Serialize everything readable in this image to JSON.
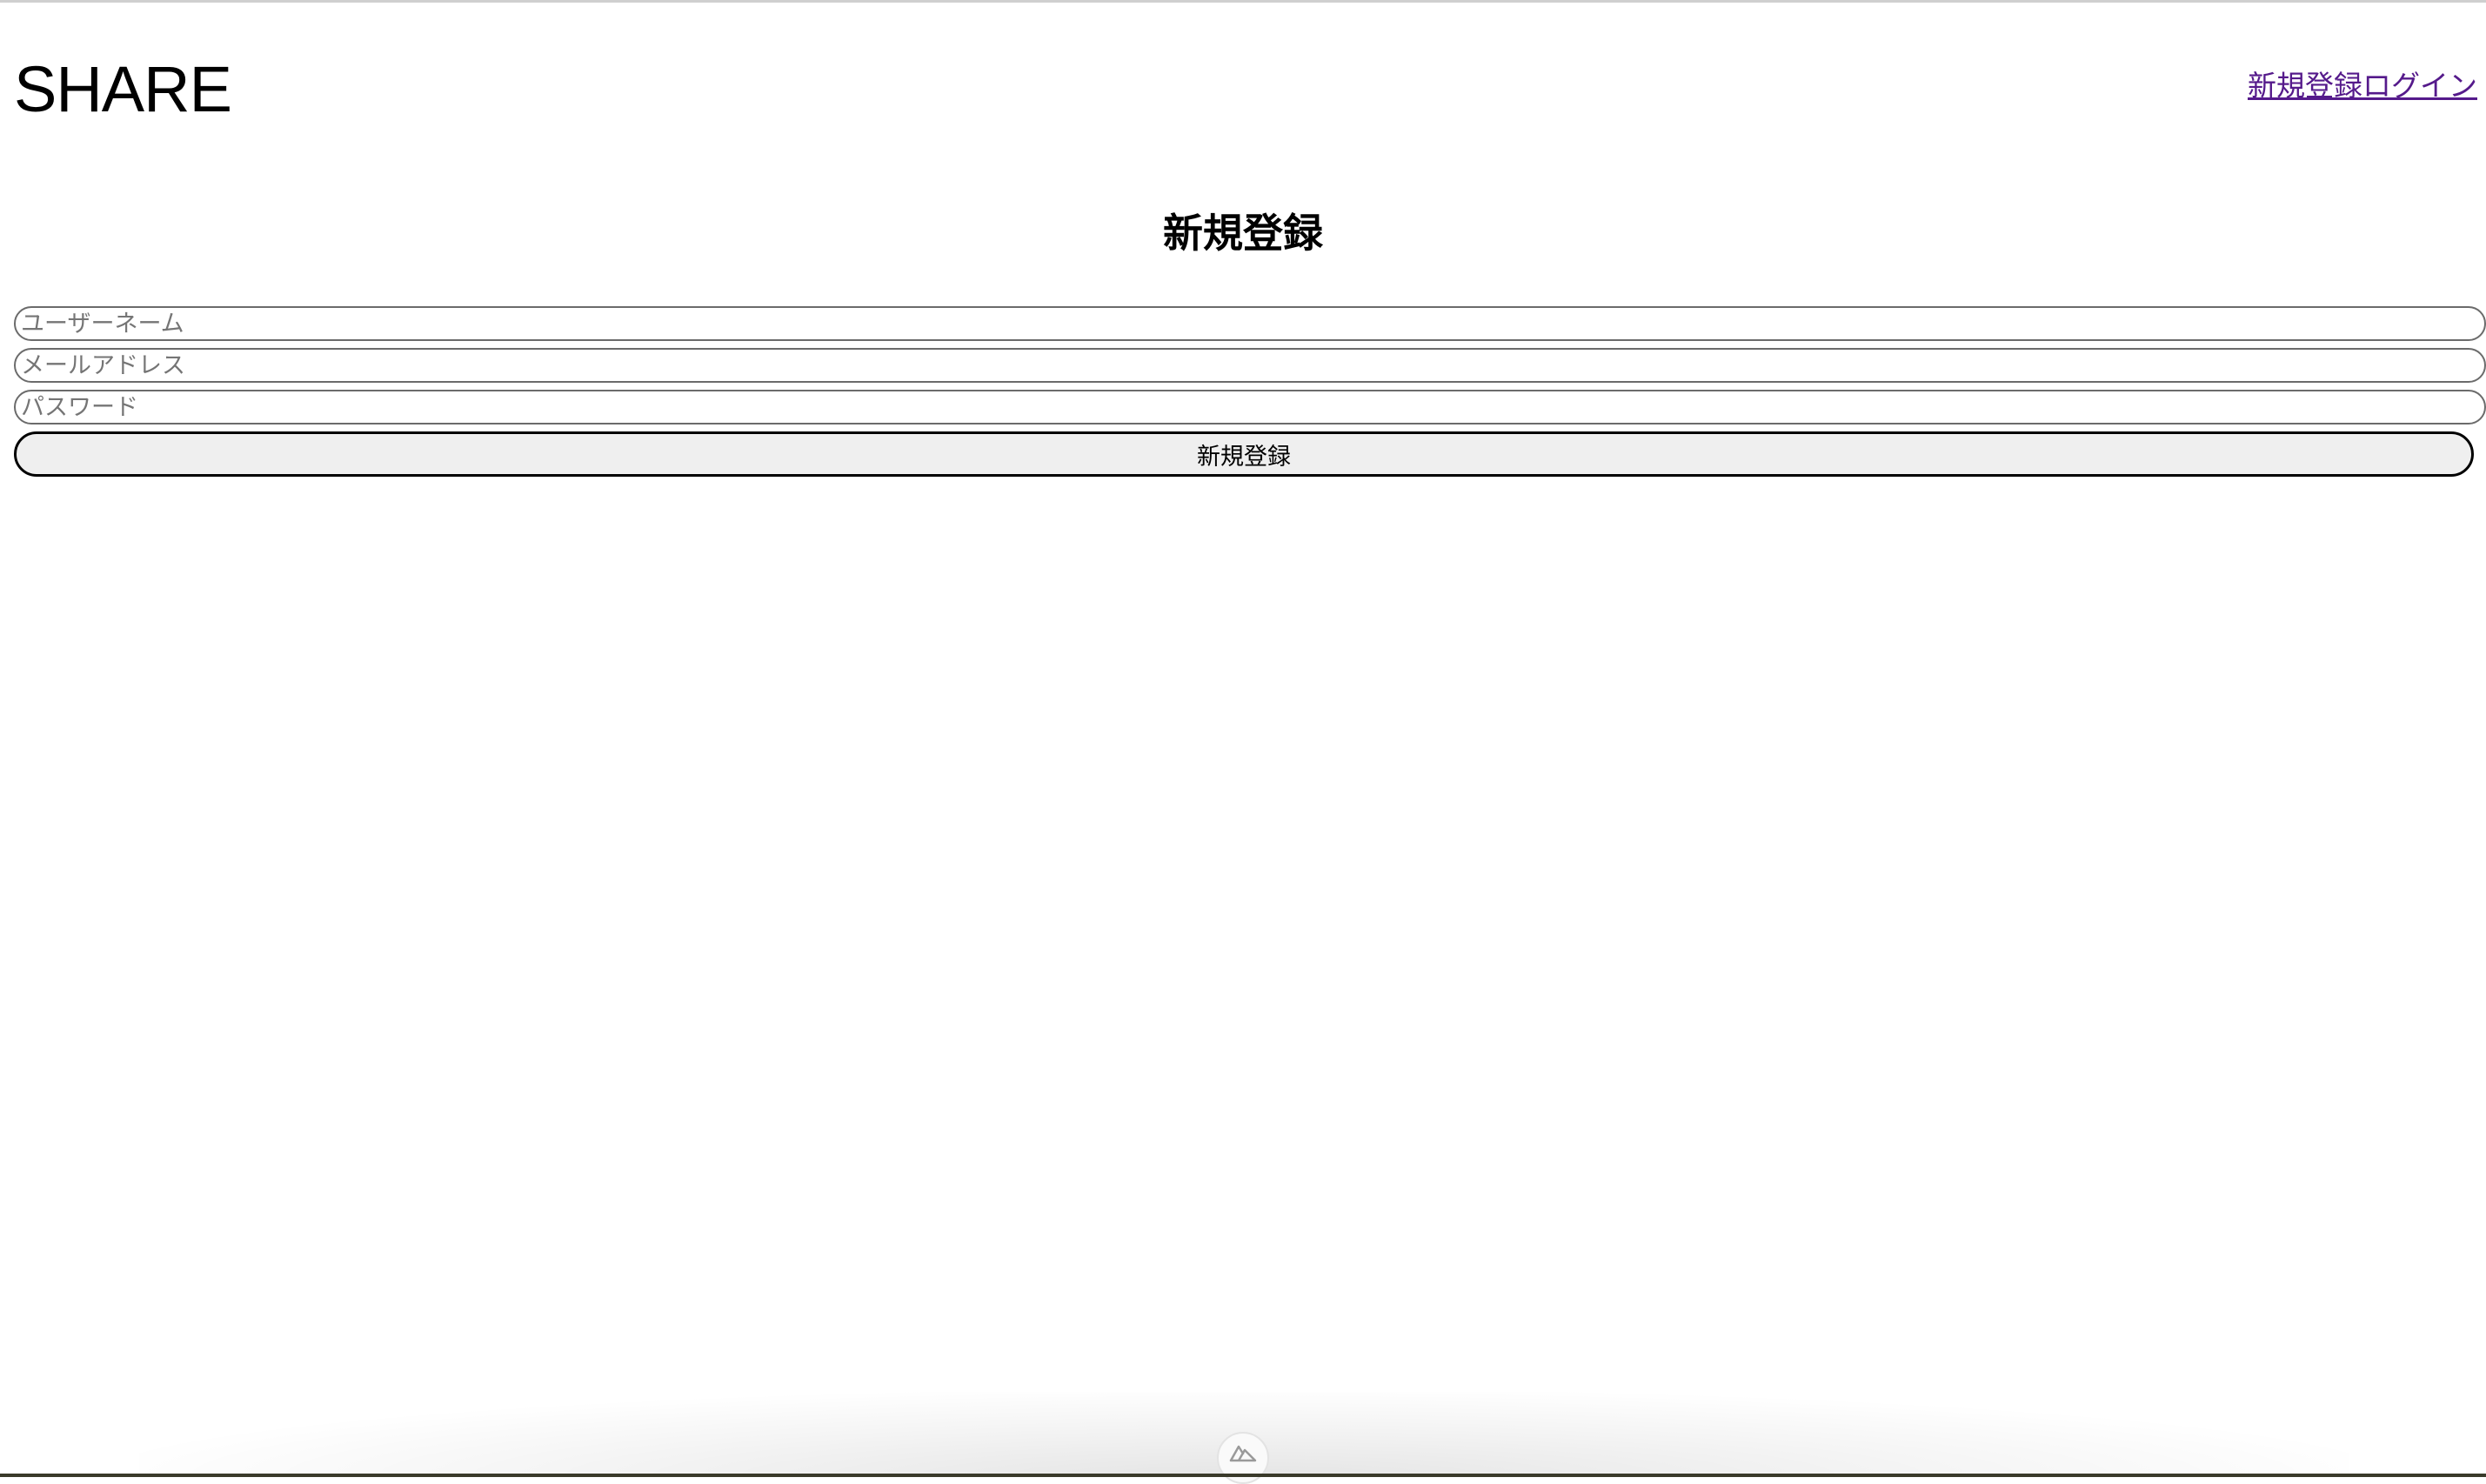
{
  "header": {
    "logo": "SHARE",
    "links": [
      {
        "label": "新規登録"
      },
      {
        "label": "ログイン"
      }
    ]
  },
  "main": {
    "title": "新規登録",
    "form": {
      "username_placeholder": "ユーザーネーム",
      "email_placeholder": "メールアドレス",
      "password_placeholder": "パスワード",
      "submit_label": "新規登録"
    }
  },
  "devtools": {
    "icon": "nuxt-logo-icon"
  }
}
